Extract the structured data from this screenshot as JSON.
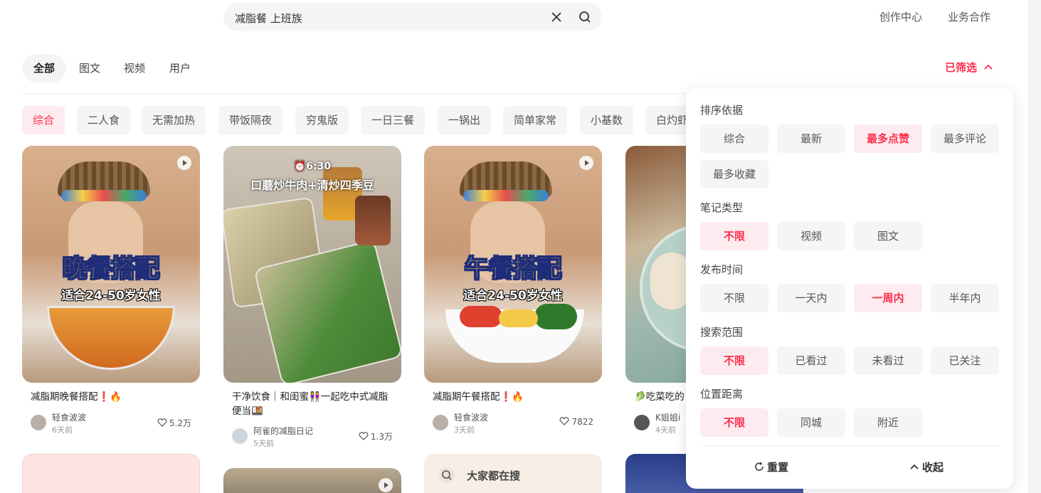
{
  "search": {
    "query": "减脂餐 上班族"
  },
  "top_links": [
    "创作中心",
    "业务合作"
  ],
  "tabs": [
    "全部",
    "图文",
    "视频",
    "用户"
  ],
  "filtered_label": "已筛选",
  "chips": [
    "综合",
    "二人食",
    "无需加热",
    "带饭隔夜",
    "穷鬼版",
    "一日三餐",
    "一锅出",
    "简单家常",
    "小基数",
    "白灼虾"
  ],
  "cards": [
    {
      "title": "减脂期晚餐搭配❗🔥",
      "author": "轻食波波",
      "ago": "6天前",
      "likes": "5.2万",
      "cover_big": "晚餐搭配",
      "cover_sub": "适合24-50岁女性"
    },
    {
      "title": "干净饮食｜和闺蜜👭一起吃中式减脂便当🍱",
      "author": "阿雀的减脂日记",
      "ago": "5天前",
      "likes": "1.3万",
      "cover_time": "⏰6:30",
      "cover_caption": "口蘑炒牛肉+清炒四季豆"
    },
    {
      "title": "减脂期午餐搭配❗🔥",
      "author": "轻食波波",
      "ago": "3天前",
      "likes": "7822",
      "cover_big": "午餐搭配",
      "cover_sub": "适合24-50岁女性"
    },
    {
      "title": "🥬吃菜吃的",
      "author": "K姐姐i",
      "ago": "4天前",
      "likes": ""
    }
  ],
  "trending_label": "大家都在搜",
  "panel": {
    "sections": [
      {
        "title": "排序依据",
        "options": [
          "综合",
          "最新",
          "最多点赞",
          "最多评论",
          "最多收藏"
        ],
        "selected": "最多点赞"
      },
      {
        "title": "笔记类型",
        "options": [
          "不限",
          "视频",
          "图文"
        ],
        "selected": "不限"
      },
      {
        "title": "发布时间",
        "options": [
          "不限",
          "一天内",
          "一周内",
          "半年内"
        ],
        "selected": "一周内"
      },
      {
        "title": "搜索范围",
        "options": [
          "不限",
          "已看过",
          "未看过",
          "已关注"
        ],
        "selected": "不限"
      },
      {
        "title": "位置距离",
        "options": [
          "不限",
          "同城",
          "附近"
        ],
        "selected": "不限"
      }
    ],
    "reset_label": "重置",
    "collapse_label": "收起"
  },
  "colors": {
    "accent": "#ff2e4d",
    "chip_bg": "#f5f5f5",
    "selected_bg": "#fdebef"
  }
}
